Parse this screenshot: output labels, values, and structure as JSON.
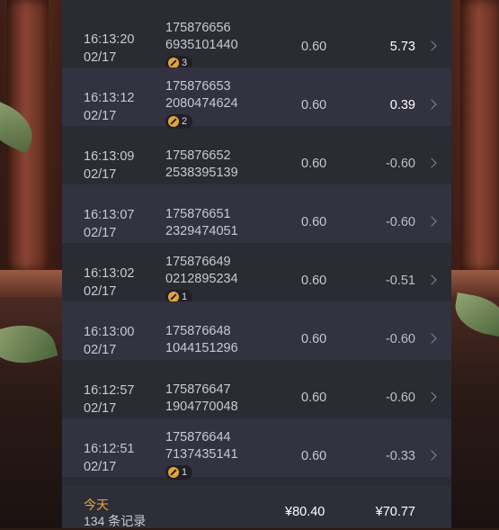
{
  "rows": [
    {
      "time": "16:13:20",
      "date": "02/17",
      "id1": "175876656",
      "id2": "6935101440",
      "badge": "3",
      "price": "0.60",
      "change": "5.73",
      "positive": true
    },
    {
      "time": "16:13:12",
      "date": "02/17",
      "id1": "175876653",
      "id2": "2080474624",
      "badge": "2",
      "price": "0.60",
      "change": "0.39",
      "positive": true
    },
    {
      "time": "16:13:09",
      "date": "02/17",
      "id1": "175876652",
      "id2": "2538395139",
      "badge": null,
      "price": "0.60",
      "change": "-0.60",
      "positive": false
    },
    {
      "time": "16:13:07",
      "date": "02/17",
      "id1": "175876651",
      "id2": "2329474051",
      "badge": null,
      "price": "0.60",
      "change": "-0.60",
      "positive": false
    },
    {
      "time": "16:13:02",
      "date": "02/17",
      "id1": "175876649",
      "id2": "0212895234",
      "badge": "1",
      "price": "0.60",
      "change": "-0.51",
      "positive": false
    },
    {
      "time": "16:13:00",
      "date": "02/17",
      "id1": "175876648",
      "id2": "1044151296",
      "badge": null,
      "price": "0.60",
      "change": "-0.60",
      "positive": false
    },
    {
      "time": "16:12:57",
      "date": "02/17",
      "id1": "175876647",
      "id2": "1904770048",
      "badge": null,
      "price": "0.60",
      "change": "-0.60",
      "positive": false
    },
    {
      "time": "16:12:51",
      "date": "02/17",
      "id1": "175876644",
      "id2": "7137435141",
      "badge": "1",
      "price": "0.60",
      "change": "-0.33",
      "positive": false
    }
  ],
  "summary": {
    "day_label": "今天",
    "count_label": "134 条记录",
    "total_bet": "¥80.40",
    "total_win": "¥70.77"
  },
  "colors": {
    "panel": "#2b2b33",
    "row_alt": "#323240",
    "accent": "#e8a73c",
    "badge_icon": "#e0a43a"
  },
  "icons": {
    "badge": "multiplier-badge-icon",
    "row_arrow": "chevron-right-icon"
  }
}
